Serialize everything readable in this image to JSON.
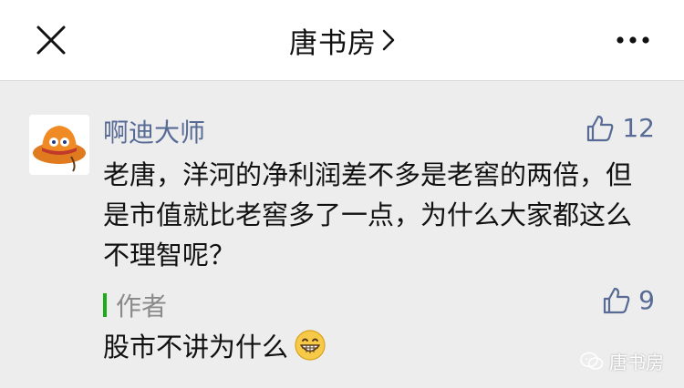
{
  "header": {
    "title": "唐书房",
    "close_icon": "close-icon",
    "more_icon": "more-icon",
    "chevron_icon": "chevron-right-icon"
  },
  "comment": {
    "nickname": "啊迪大师",
    "likes": "12",
    "text": "老唐，洋河的净利润差不多是老窖的两倍，但是市值就比老窖多了一点，为什么大家都这么不理智呢？",
    "avatar_icon": "avatar-hat-icon"
  },
  "reply": {
    "author_label": "作者",
    "likes": "9",
    "text": "股市不讲为什么",
    "emoji": "grinning-face-icon"
  },
  "watermark": {
    "text": "唐书房"
  },
  "colors": {
    "link_blue": "#576b95",
    "author_green": "#1aad19",
    "background": "#ededed"
  }
}
